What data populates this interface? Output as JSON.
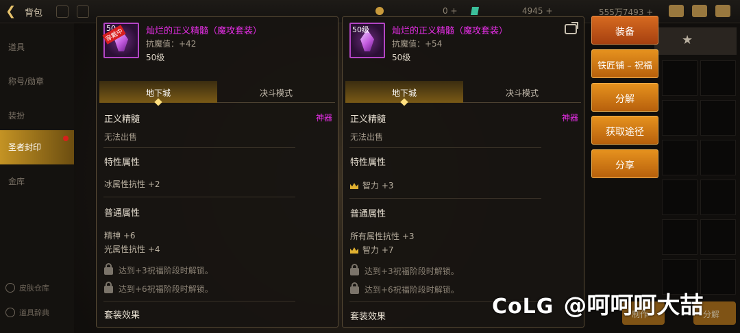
{
  "header": {
    "title": "背包",
    "gold": "0",
    "gems": "4945",
    "money": "555万7493"
  },
  "sidebar": {
    "items": [
      {
        "label": "道具"
      },
      {
        "label": "称号/勋章"
      },
      {
        "label": "装扮"
      },
      {
        "label": "圣者封印"
      },
      {
        "label": "金库"
      }
    ],
    "bottom": [
      {
        "label": "皮肤仓库"
      },
      {
        "label": "道具辞典"
      }
    ]
  },
  "left_panel": {
    "icon_level": "50",
    "equipped_tag": "穿戴中",
    "name": "灿烂的正义精髓（魔攻套装）",
    "stat": "抗魔值：+42",
    "level": "50级",
    "tabs": [
      "地下城",
      "决斗模式"
    ],
    "type": "正义精髓",
    "rarity": "神器",
    "sell": "无法出售",
    "special_title": "特性属性",
    "special_attrs": [
      "冰属性抗性 +2"
    ],
    "normal_title": "普通属性",
    "normal_attrs": [
      "精神 +6",
      "光属性抗性 +4"
    ],
    "locked": [
      "达到+3祝福阶段时解锁。",
      "达到+6祝福阶段时解锁。"
    ],
    "set_title": "套装效果"
  },
  "right_panel": {
    "icon_level": "50级",
    "name": "灿烂的正义精髓（魔攻套装）",
    "stat": "抗魔值：+54",
    "level": "50级",
    "tabs": [
      "地下城",
      "决斗模式"
    ],
    "type": "正义精髓",
    "rarity": "神器",
    "sell": "无法出售",
    "special_title": "特性属性",
    "special_attrs": [
      "智力 +3"
    ],
    "normal_title": "普通属性",
    "normal_attrs": [
      "所有属性抗性 +3",
      "智力 +7"
    ],
    "locked": [
      "达到+3祝福阶段时解锁。",
      "达到+6祝福阶段时解锁。"
    ],
    "set_title": "套装效果"
  },
  "actions": [
    "装备",
    "铁匠铺 – 祝福",
    "分解",
    "获取途径",
    "分享"
  ],
  "bottom_buttons": [
    "制作",
    "分解"
  ],
  "watermark": {
    "logo": "CoLG",
    "user": "@呵呵呵大喆"
  },
  "colors": {
    "item_name": "#e62ee6",
    "action_button": "#d98419",
    "nav_active": "#c49324"
  }
}
